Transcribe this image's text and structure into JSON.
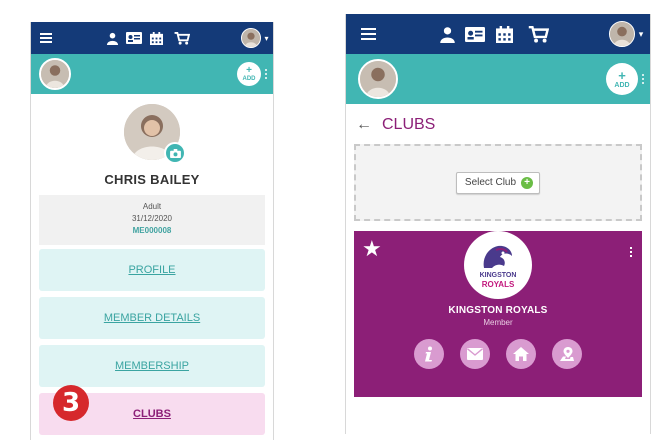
{
  "profile": {
    "name": "CHRIS BAILEY",
    "category": "Adult",
    "date": "31/12/2020",
    "member_code": "ME000008"
  },
  "add_button_label": "ADD",
  "add_button_plus": "+",
  "menu": [
    {
      "label": "PROFILE"
    },
    {
      "label": "MEMBER DETAILS"
    },
    {
      "label": "MEMBERSHIP"
    },
    {
      "label": "CLUBS"
    }
  ],
  "step_number": "3",
  "clubs_page": {
    "title": "CLUBS",
    "back_glyph": "←",
    "select_club_label": "Select Club",
    "select_club_plus": "+",
    "star_glyph": "★",
    "club": {
      "name": "KINGSTON ROYALS",
      "role": "Member",
      "logo_text_top": "KINGSTON",
      "logo_text_bottom": "ROYALS"
    }
  },
  "colors": {
    "navy": "#143a78",
    "teal": "#41b6b3",
    "club_purple": "#8c1f77",
    "badge_red": "#d6282c"
  },
  "icons": [
    "menu-icon",
    "person-icon",
    "id-card-icon",
    "calendar-icon",
    "cart-icon",
    "avatar",
    "camera-icon",
    "star-icon",
    "info-icon",
    "mail-icon",
    "home-icon",
    "map-pin-icon"
  ]
}
